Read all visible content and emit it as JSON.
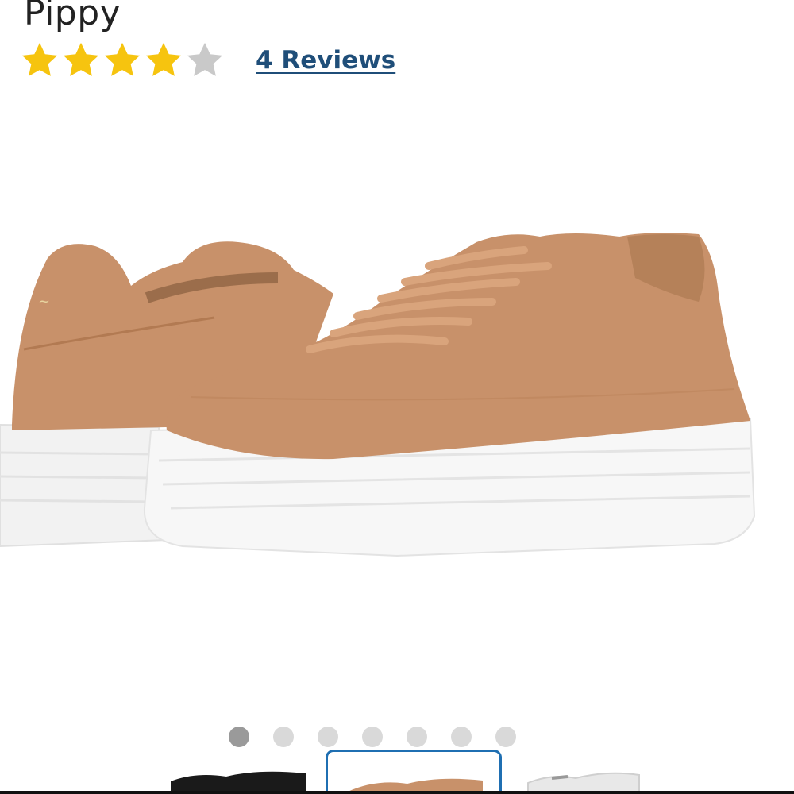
{
  "product": {
    "name": "Pippy"
  },
  "rating": {
    "stars_filled": 4,
    "stars_total": 5,
    "star_color": "#f6c40f",
    "star_empty_color": "#c9c9c9",
    "reviews_label": "4 Reviews"
  },
  "gallery": {
    "image_count": 7,
    "active_index": 0,
    "thumbnails": [
      {
        "name": "black",
        "color": "#1a1a1a"
      },
      {
        "name": "tan",
        "color": "#c8916a"
      },
      {
        "name": "white",
        "color": "#e8e8e8"
      }
    ],
    "selected_thumbnail": 1
  },
  "colors": {
    "link": "#1f4e79",
    "selected_border": "#1f6fb2",
    "leather": "#c8916a",
    "sole": "#f4f4f4"
  }
}
